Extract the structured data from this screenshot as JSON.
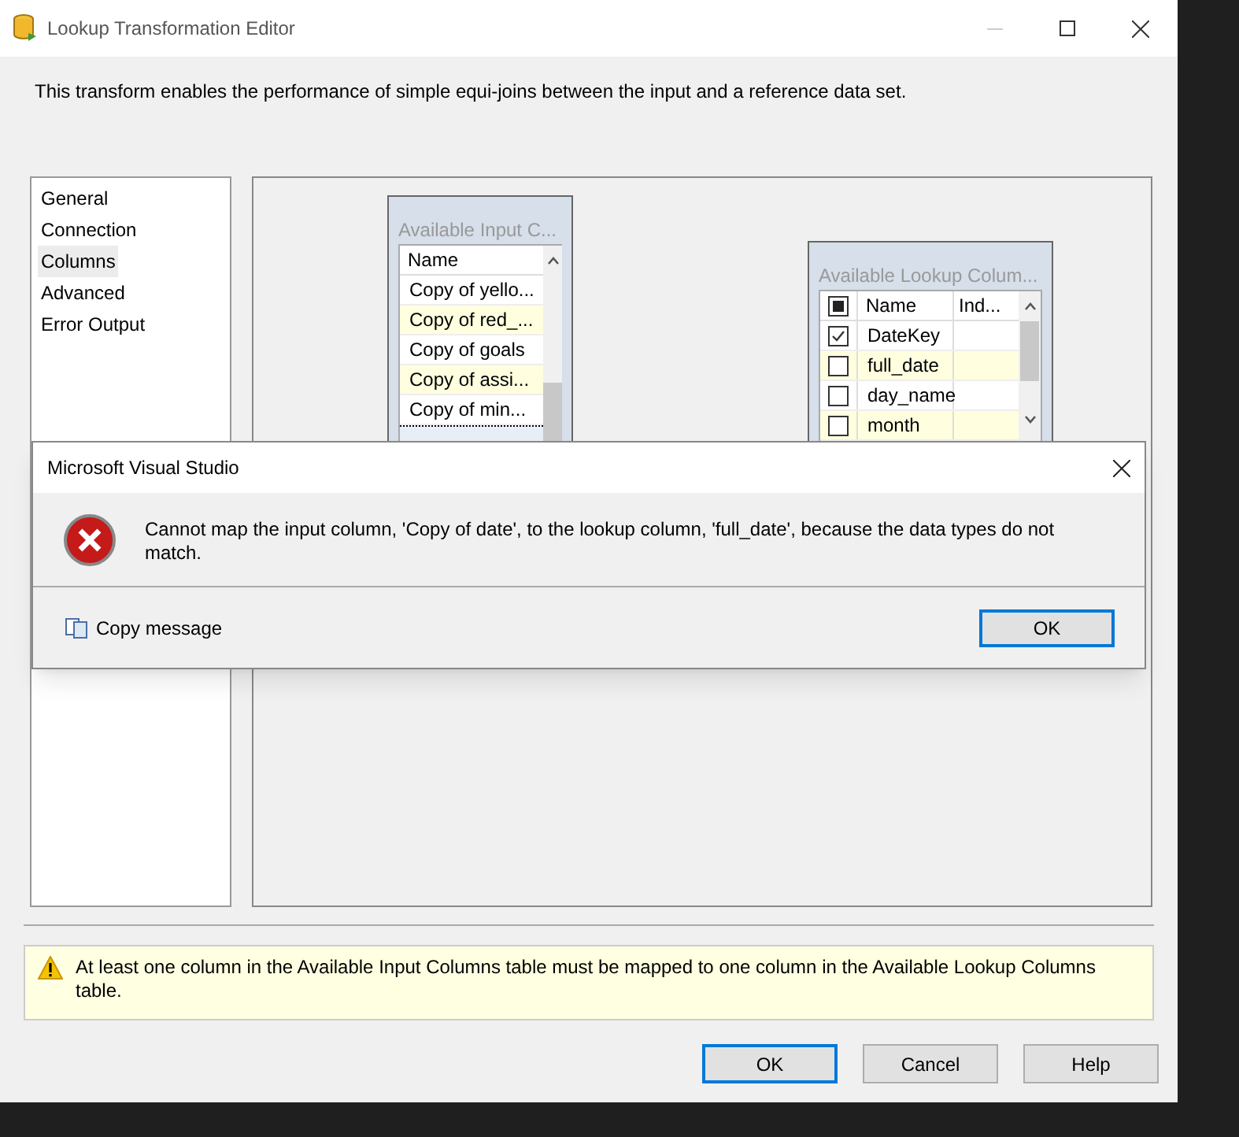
{
  "window": {
    "title": "Lookup Transformation Editor"
  },
  "description": "This transform enables the performance of simple equi-joins between the input and a reference data set.",
  "nav": [
    {
      "label": "General",
      "selected": false
    },
    {
      "label": "Connection",
      "selected": false
    },
    {
      "label": "Columns",
      "selected": true
    },
    {
      "label": "Advanced",
      "selected": false
    },
    {
      "label": "Error Output",
      "selected": false
    }
  ],
  "input_table": {
    "title": "Available Input C...",
    "columns": [
      "Name"
    ],
    "rows": [
      {
        "name": "Copy of yello...",
        "selected": false
      },
      {
        "name": "Copy of red_...",
        "selected": false
      },
      {
        "name": "Copy of goals",
        "selected": false
      },
      {
        "name": "Copy of assi...",
        "selected": false
      },
      {
        "name": "Copy of min...",
        "selected": false
      }
    ]
  },
  "lookup_table": {
    "title": "Available Lookup Colum...",
    "header_checked": true,
    "columns": [
      "Name",
      "Ind..."
    ],
    "rows": [
      {
        "name": "DateKey",
        "checked": true
      },
      {
        "name": "full_date",
        "checked": false
      },
      {
        "name": "day_name",
        "checked": false
      },
      {
        "name": "month",
        "checked": false
      }
    ]
  },
  "dialog": {
    "title": "Microsoft Visual Studio",
    "message": "Cannot map the input column, 'Copy of date', to the lookup column, 'full_date', because the data types do not match.",
    "copy_link": "Copy message",
    "button": "OK"
  },
  "warning": "At least one column in the Available Input Columns table must be mapped to one column in the Available Lookup Columns table.",
  "buttons": [
    {
      "label": "OK",
      "default": true
    },
    {
      "label": "Cancel",
      "default": false
    },
    {
      "label": "Help",
      "default": false
    }
  ]
}
